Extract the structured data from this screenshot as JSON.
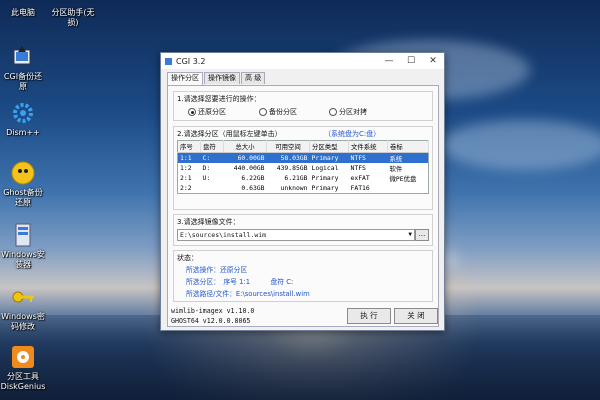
{
  "desktop": {
    "icons": [
      {
        "label": "此电脑",
        "icon": "computer-icon"
      },
      {
        "label": "CGI备份还原",
        "icon": "cgi-backup-icon"
      },
      {
        "label": "Dism++",
        "icon": "dism-gear-icon"
      },
      {
        "label": "Ghost备份还原",
        "icon": "ghost-icon"
      },
      {
        "label": "Windows安装器",
        "icon": "windows-installer-icon"
      },
      {
        "label": "Windows密码修改",
        "icon": "key-icon"
      },
      {
        "label": "分区工具DiskGenius",
        "icon": "diskgenius-icon"
      }
    ],
    "top_second_label": "分区助手(无损)"
  },
  "window": {
    "title": "CGI 3.2",
    "tabs": [
      "操作分区",
      "操作镜像",
      "高 级"
    ],
    "section1_label": "1.请选择您要进行的操作：",
    "operations": [
      {
        "label": "还原分区",
        "selected": true
      },
      {
        "label": "备份分区",
        "selected": false
      },
      {
        "label": "分区对拷",
        "selected": false
      }
    ],
    "section2_label": "2.请选择分区（用鼠标左键单击）",
    "system_disk_note": "（系统盘为C:盘）",
    "table": {
      "headers": [
        "序号",
        "盘符",
        "总大小",
        "可用空间",
        "分区类型",
        "文件系统",
        "卷标"
      ],
      "rows": [
        [
          "1:1",
          "C:",
          "60.00GB",
          "58.03GB",
          "Primary",
          "NTFS",
          "系统"
        ],
        [
          "1:2",
          "D:",
          "440.00GB",
          "439.85GB",
          "Logical",
          "NTFS",
          "软件"
        ],
        [
          "2:1",
          "U:",
          "6.22GB",
          "6.21GB",
          "Primary",
          "exFAT",
          "微PE优盘"
        ],
        [
          "2:2",
          "",
          "0.63GB",
          "unknown",
          "Primary",
          "FAT16",
          ""
        ]
      ],
      "selected_row": 0
    },
    "section3_label": "3.请选择镜像文件：",
    "image_path": "E:\\sources\\install.wim",
    "browse_label": "...",
    "status": {
      "title": "状态：",
      "op_label": "所选操作：还原分区",
      "part_label": "所选分区：　序号 1:1　　　盘符 C:",
      "path_label": "所选路径/文件：E:\\sources\\install.wim"
    },
    "footer": {
      "wimlib": "wimlib-imagex v1.10.0",
      "ghost": "GHOST64 v12.0.0.8065"
    },
    "execute_label": "执 行",
    "close_label": "关 闭"
  }
}
